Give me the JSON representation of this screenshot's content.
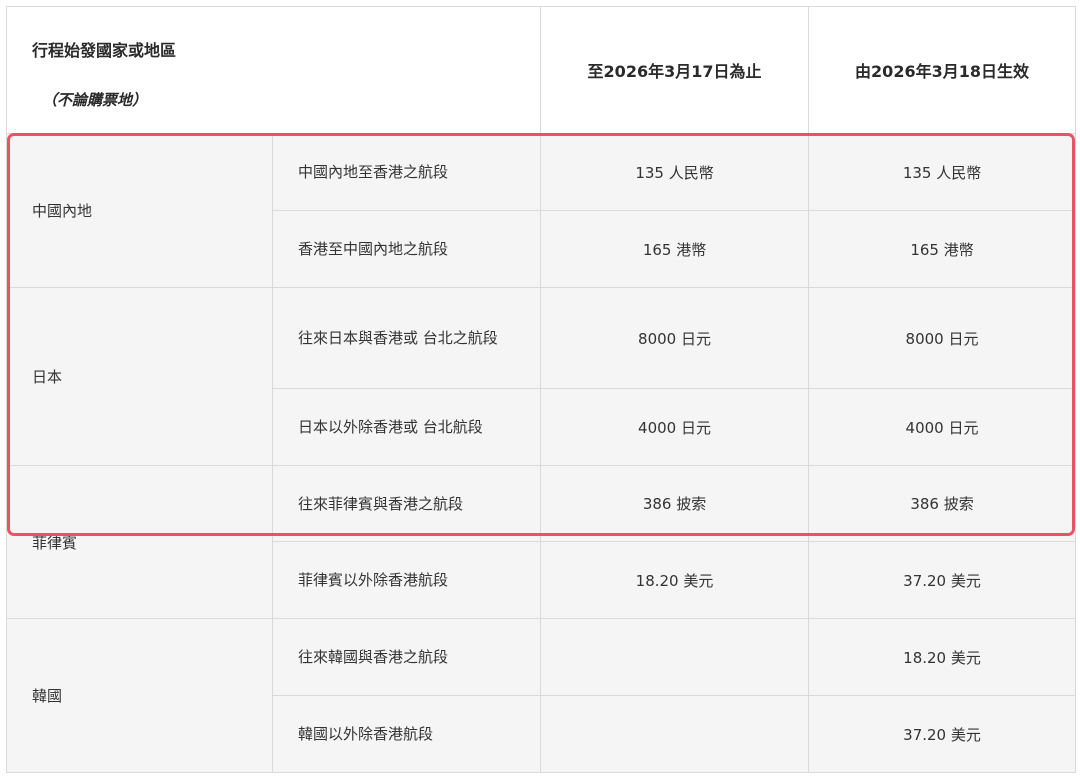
{
  "header": {
    "origin_title": "行程始發國家或地區",
    "origin_note": "（不論購票地）",
    "col_until": "至2026年3月17日為止",
    "col_from": "由2026年3月18日生效"
  },
  "rows": {
    "r0": {
      "country": "中國內地",
      "segment": "中國內地至香港之航段",
      "until": "135 人民幣",
      "from": "135 人民幣"
    },
    "r1": {
      "segment": "香港至中國內地之航段",
      "until": "165 港幣",
      "from": "165 港幣"
    },
    "r2": {
      "country": "日本",
      "segment": "往來日本與香港或 台北之航段",
      "until": "8000 日元",
      "from": "8000 日元"
    },
    "r3": {
      "segment": "日本以外除香港或 台北航段",
      "until": "4000 日元",
      "from": "4000 日元"
    },
    "r4": {
      "country": "菲律賓",
      "segment": "往來菲律賓與香港之航段",
      "until": "386 披索",
      "from": "386 披索"
    },
    "r5": {
      "segment": "菲律賓以外除香港航段",
      "until": "18.20 美元",
      "from": "37.20 美元"
    },
    "r6": {
      "country": "韓國",
      "segment": "往來韓國與香港之航段",
      "until": "",
      "from": "18.20 美元"
    },
    "r7": {
      "segment": "韓國以外除香港航段",
      "until": "",
      "from": "37.20 美元"
    }
  },
  "highlight_color": "#e85466"
}
